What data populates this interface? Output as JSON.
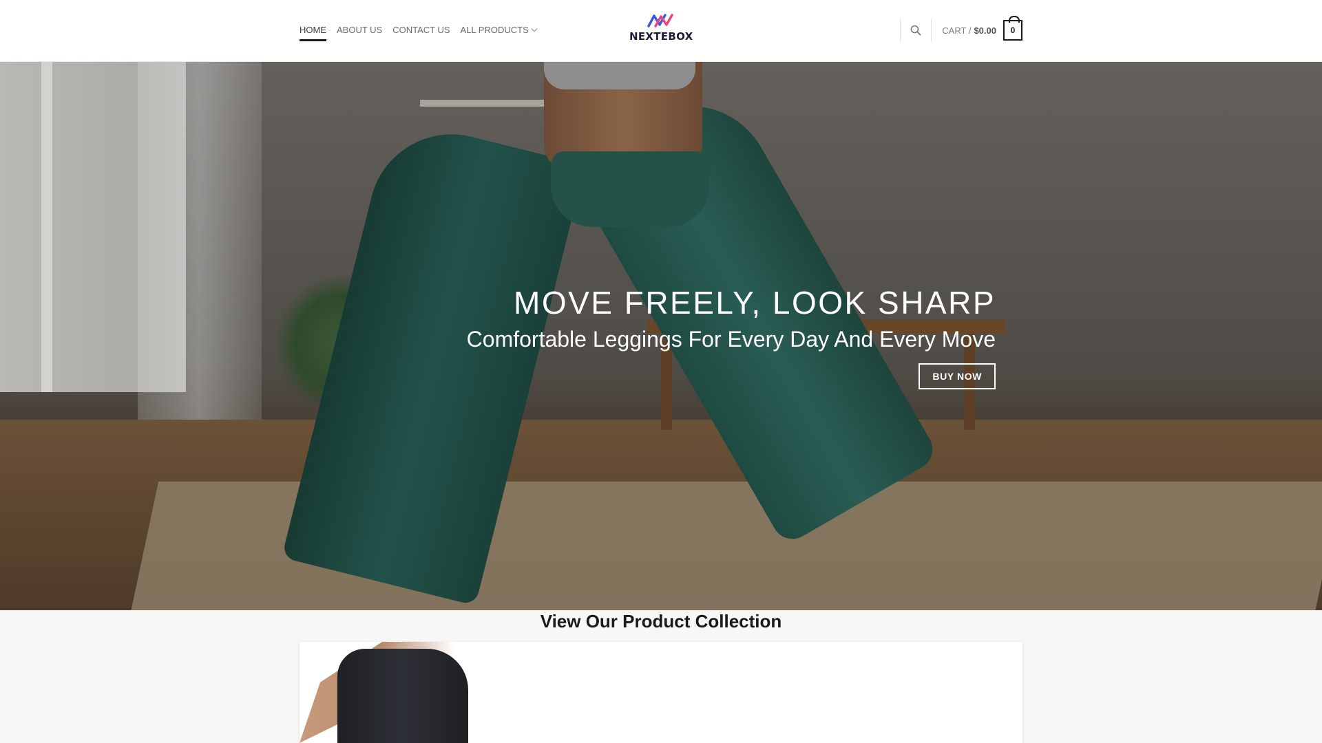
{
  "header": {
    "nav": [
      {
        "label": "HOME",
        "active": true
      },
      {
        "label": "ABOUT US",
        "active": false
      },
      {
        "label": "CONTACT US",
        "active": false
      },
      {
        "label": "ALL PRODUCTS",
        "active": false,
        "has_dropdown": true
      }
    ],
    "logo_text": "NEXTEBOX",
    "search_icon": "search-icon",
    "cart": {
      "label": "CART /",
      "total": "$0.00",
      "count": "0"
    }
  },
  "hero": {
    "title": "MOVE FREELY, LOOK SHARP",
    "subtitle": "Comfortable Leggings For Every Day And Every Move",
    "button_label": "BUY NOW"
  },
  "collection": {
    "title": "View Our Product Collection"
  },
  "colors": {
    "accent_blue": "#3b5bdb",
    "accent_pink": "#e64980",
    "text_dark": "#1a1a1a"
  }
}
